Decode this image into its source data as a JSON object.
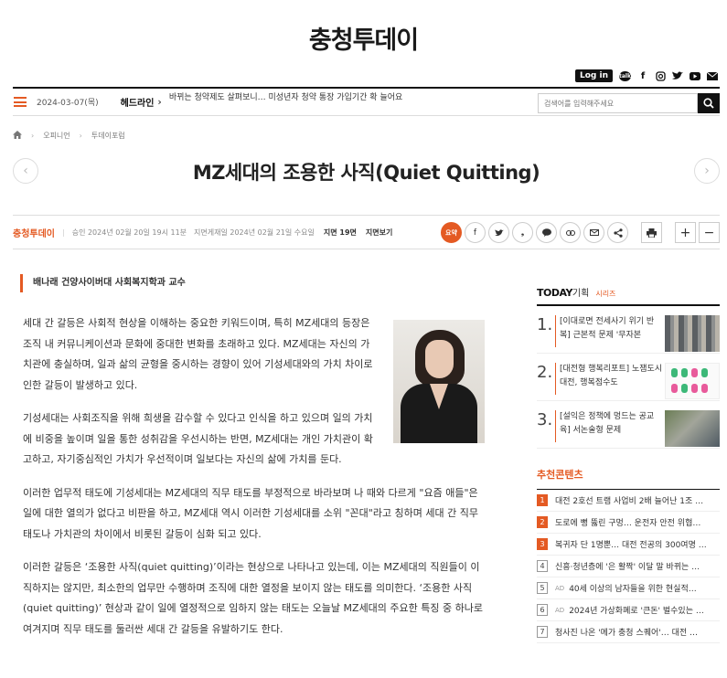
{
  "site": {
    "name": "충청투데이"
  },
  "topbar": {
    "login": "Log in",
    "icons": [
      "kakaotalk-icon",
      "facebook-icon",
      "instagram-icon",
      "twitter-icon",
      "youtube-icon",
      "newsletter-icon"
    ]
  },
  "nav": {
    "date": "2024-03-07(목)",
    "headline_label": "헤드라인",
    "headline_text": "바뀌는 청약제도 살펴보니… 미성년자 청약 통장 가입기간 확 늘어요",
    "search_placeholder": "검색어를 입력해주세요"
  },
  "breadcrumb": [
    "오피니언",
    "투데이포럼"
  ],
  "article": {
    "title": "MZ세대의 조용한 사직(Quiet Quitting)",
    "source": "충청투데이",
    "approved": "승인 2024년 02월 20일 19시 11분",
    "print_date": "지면게재일 2024년 02월 21일 수요일",
    "page": "지면 19면",
    "view_page": "지면보기",
    "summary_label": "요약",
    "byline": "배나래 건양사이버대 사회복지학과 교수",
    "paragraphs": [
      "세대 간 갈등은 사회적 현상을 이해하는 중요한 키워드이며, 특히 MZ세대의 등장은 조직 내 커뮤니케이션과 문화에 중대한 변화를 초래하고 있다. MZ세대는 자신의 가치관에 충실하며, 일과 삶의 균형을 중시하는 경향이 있어 기성세대와의 가치 차이로 인한 갈등이 발생하고 있다.",
      "기성세대는 사회조직을 위해 희생을 감수할 수 있다고 인식을 하고 있으며 일의 가치에 비중을 높이며 일을 통한 성취감을 우선시하는 반면, MZ세대는 개인 가치관이 확고하고, 자기중심적인 가치가 우선적이며 일보다는 자신의 삶에 가치를 둔다.",
      "이러한 업무적 태도에 기성세대는 MZ세대의 직무 태도를 부정적으로 바라보며 나 때와 다르게 \"요즘 애들\"은 일에 대한 열의가 없다고 비판을 하고, MZ세대 역시 이러한 기성세대를 소위 \"꼰대\"라고 칭하며 세대 간 직무 태도나 가치관의 차이에서 비롯된 갈등이 심화 되고 있다.",
      "이러한 갈등은 ‘조용한 사직(quiet quitting)’이라는 현상으로 나타나고 있는데, 이는 MZ세대의 직원들이 이직하지는 않지만, 최소한의 업무만 수행하며 조직에 대한 열정을 보이지 않는 태도를 의미한다. ‘조용한 사직(quiet quitting)’ 현상과 같이 일에 열정적으로 임하지 않는 태도는 오늘날 MZ세대의 주요한 특징 중 하나로 여겨지며 직무 태도를 둘러싼 세대 간 갈등을 유발하기도 한다."
    ]
  },
  "sidebar": {
    "series_head_1": "TODAY",
    "series_head_2": "기획",
    "series_head_3": "시리즈",
    "series": [
      {
        "num": "1.",
        "text": "[이대로면 전세사기 위기 반복] 근본적 문제 '무자본"
      },
      {
        "num": "2.",
        "text": "[대전형 행복리포트] 노잼도시 대전, 행복점수도"
      },
      {
        "num": "3.",
        "text": "[설익은 정책에 멍드는 공교육] 서논술형 문제"
      }
    ],
    "rec_head": "추천콘텐츠",
    "recs": [
      {
        "num": "1",
        "ad": "",
        "text": "대전 2호선 트램 사업비 2배 늘어난 1조 …"
      },
      {
        "num": "2",
        "ad": "",
        "text": "도로에 뻥 뚫린 구멍… 운전자 안전 위협…"
      },
      {
        "num": "3",
        "ad": "",
        "text": "복귀자 단 1명뿐… 대전 전공의 300여명 …"
      },
      {
        "num": "4",
        "ad": "",
        "text": "신흥·청년층에 '은 활짝' 이달 말 바뀌는 …"
      },
      {
        "num": "5",
        "ad": "AD",
        "text": "40세 이상의 남자들을 위한 현실적…"
      },
      {
        "num": "6",
        "ad": "AD",
        "text": "2024년 가상화폐로 '큰돈' 벌수있는 …"
      },
      {
        "num": "7",
        "ad": "",
        "text": "청사진 나온 '메가 충청 스퀘어'… 대전 …"
      }
    ]
  },
  "colors": {
    "accent": "#e45a23",
    "dark": "#111111"
  }
}
